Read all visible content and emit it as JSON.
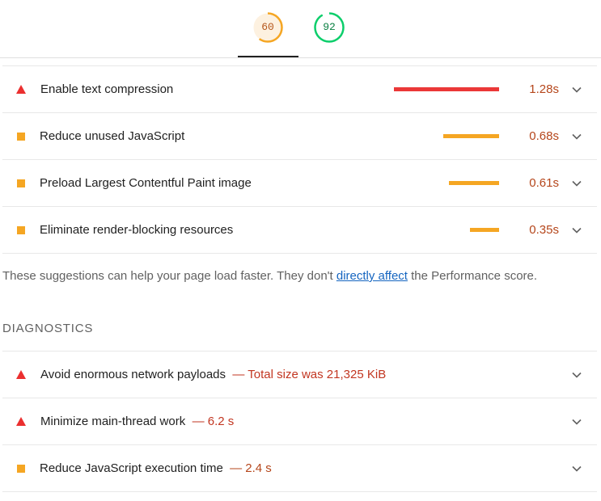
{
  "gauges": [
    {
      "score": "60",
      "rating": "average",
      "fraction": 0.6,
      "color": "#f5a623",
      "bg": "#fdf1e0"
    },
    {
      "score": "92",
      "rating": "pass",
      "fraction": 0.92,
      "color": "#0cce6b",
      "bg": "#ffffff"
    }
  ],
  "opportunities": [
    {
      "title": "Enable text compression",
      "rating": "fail",
      "savings": "1.28s",
      "savings_seconds": 1.28
    },
    {
      "title": "Reduce unused JavaScript",
      "rating": "average",
      "savings": "0.68s",
      "savings_seconds": 0.68
    },
    {
      "title": "Preload Largest Contentful Paint image",
      "rating": "average",
      "savings": "0.61s",
      "savings_seconds": 0.61
    },
    {
      "title": "Eliminate render-blocking resources",
      "rating": "average",
      "savings": "0.35s",
      "savings_seconds": 0.35
    }
  ],
  "note": {
    "before": "These suggestions can help your page load faster. They don't ",
    "link": "directly affect",
    "after": " the Performance score."
  },
  "diagnostics_title": "DIAGNOSTICS",
  "diagnostics": [
    {
      "title": "Avoid enormous network payloads",
      "rating": "fail",
      "display": "— Total size was 21,325 KiB"
    },
    {
      "title": "Minimize main-thread work",
      "rating": "fail",
      "display": "— 6.2 s"
    },
    {
      "title": "Reduce JavaScript execution time",
      "rating": "average",
      "display": "— 2.4 s"
    }
  ],
  "colors": {
    "fail": "#eb2f2f",
    "average": "#f5a623",
    "pass": "#0cce6b",
    "link": "#1565c0"
  },
  "icons": {
    "expand": "chevron-down-icon"
  }
}
